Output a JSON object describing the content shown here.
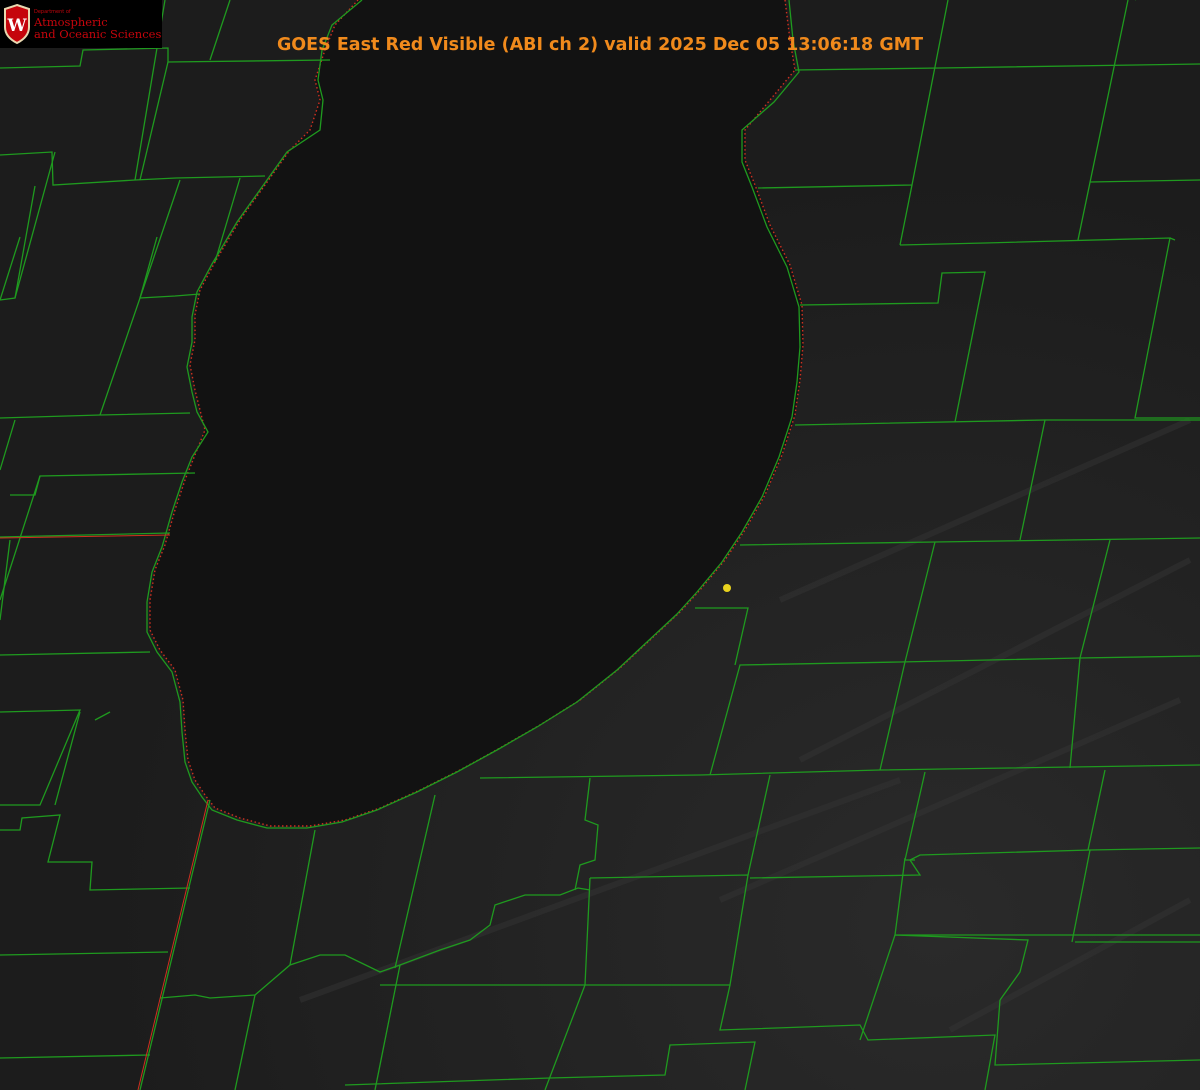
{
  "title": "GOES East Red Visible (ABI ch 2) valid 2025 Dec 05 13:06:18 GMT",
  "logo": {
    "emblem_letter": "W",
    "dept_line": "Department of",
    "line1": "Atmospheric",
    "line2": "and Oceanic Sciences"
  },
  "colors": {
    "title": "#f08a1c",
    "logo_text": "#c5050c",
    "county_lines": "#1f9a1f",
    "lake_outline": "#d03020",
    "marker": "#e8d21e",
    "lake_fill": "#111111",
    "land_fill": "#222222"
  },
  "map_features": {
    "boundaries": "county-lines",
    "lake": "lake-michigan-southern-basin",
    "marker_icon": "yellow-dot-icon"
  }
}
